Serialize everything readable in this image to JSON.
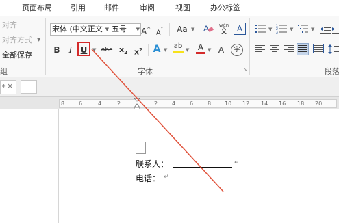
{
  "tabs": [
    "页面布局",
    "引用",
    "邮件",
    "审阅",
    "视图",
    "办公标签"
  ],
  "ribbon": {
    "paragraph_left": {
      "align_label": "对齐",
      "align_mode_label": "对齐方式",
      "save_all_label": "全部保存",
      "group_fragment": "组"
    },
    "font": {
      "font_name": "宋体 (中文正文",
      "font_size": "五号",
      "grow_glyph": "A",
      "shrink_glyph": "A",
      "change_case_label": "Aa",
      "phonetic_top": "wén",
      "phonetic_bottom": "文",
      "border_char_glyph": "A",
      "bold_glyph": "B",
      "italic_glyph": "I",
      "underline_glyph": "U",
      "strike_glyph": "abc",
      "subscript_glyph": "x",
      "subscript_mark": "2",
      "superscript_glyph": "x",
      "superscript_mark": "2",
      "text_effect_glyph": "A",
      "highlight_glyph": "ab",
      "font_color_glyph": "A",
      "enclose_glyph": "A",
      "enclose_char_glyph": "字",
      "group_label": "字体"
    },
    "paragraph": {
      "group_label": "段落"
    }
  },
  "colors": {
    "highlight_color": "#f7e21c",
    "font_color": "#d42b2b",
    "callout_color": "#e0523b",
    "accent": "#2b579a"
  },
  "doc_tabs": {
    "active_tab_label": "*",
    "close_glyph": "×"
  },
  "ruler": {
    "numbers": [
      "8",
      "6",
      "4",
      "2",
      "",
      "2",
      "4",
      "6",
      "8",
      "10",
      "12",
      "14",
      "16",
      "18",
      "20"
    ]
  },
  "document": {
    "line1_label": "联系人：",
    "line2_label": "电话："
  }
}
